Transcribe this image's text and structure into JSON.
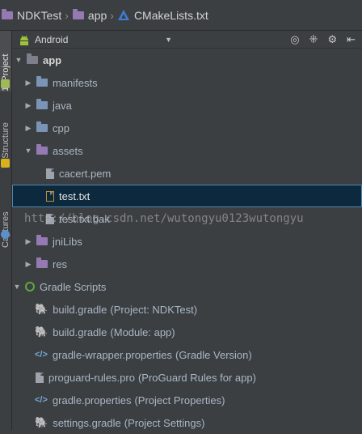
{
  "breadcrumb": {
    "items": [
      {
        "label": "NDKTest"
      },
      {
        "label": "app"
      },
      {
        "label": "CMakeLists.txt"
      }
    ]
  },
  "tool_stripe": {
    "project_label": "1: Project",
    "structure_label": "7: Structure",
    "captures_label": "Captures"
  },
  "panel": {
    "view_mode": "Android"
  },
  "tree": {
    "app": "app",
    "manifests": "manifests",
    "java": "java",
    "cpp": "cpp",
    "assets": "assets",
    "cacert": "cacert.pem",
    "test_txt": "test.txt",
    "test_bak": "test.txt.bak",
    "jnilibs": "jniLibs",
    "res": "res",
    "gradle_scripts": "Gradle Scripts",
    "gradle_files": [
      {
        "name": "build.gradle",
        "extra": "(Project: NDKTest)"
      },
      {
        "name": "build.gradle",
        "extra": "(Module: app)"
      },
      {
        "name": "gradle-wrapper.properties",
        "extra": "(Gradle Version)"
      },
      {
        "name": "proguard-rules.pro",
        "extra": "(ProGuard Rules for app)"
      },
      {
        "name": "gradle.properties",
        "extra": "(Project Properties)"
      },
      {
        "name": "settings.gradle",
        "extra": "(Project Settings)"
      }
    ]
  },
  "watermark": "http://blog.csdn.net/wutongyu0123wutongyu",
  "colors": {
    "background": "#3c3f41",
    "selection": "#0d293e",
    "selection_border": "#4e86b0",
    "text": "#a9b7c6"
  }
}
